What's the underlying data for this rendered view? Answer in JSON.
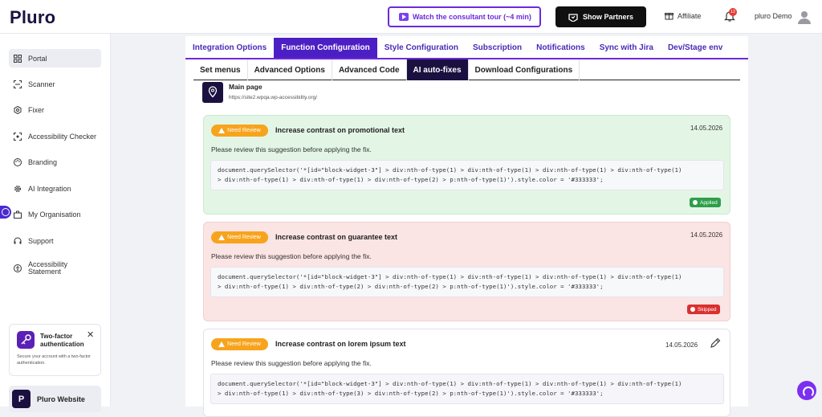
{
  "header": {
    "logo": "Pluro",
    "tour_button": "Watch the consultant tour (~4 min)",
    "partners_button": "Show Partners",
    "affiliate": "Affiliate",
    "notifications_count": "12",
    "user_name": "pluro Demo"
  },
  "sidebar": {
    "items": [
      {
        "label": "Portal",
        "icon": "grid-icon"
      },
      {
        "label": "Scanner",
        "icon": "scan-icon"
      },
      {
        "label": "Fixer",
        "icon": "fixer-icon"
      },
      {
        "label": "Accessibility Checker",
        "icon": "checker-icon"
      },
      {
        "label": "Branding",
        "icon": "palette-icon"
      },
      {
        "label": "AI Integration",
        "icon": "gear-icon"
      },
      {
        "label": "My Organisation",
        "icon": "briefcase-icon"
      },
      {
        "label": "Support",
        "icon": "headset-icon"
      },
      {
        "label": "Accessibility",
        "label2": "Statement",
        "icon": "accessibility-icon"
      }
    ],
    "twofa": {
      "title": "Two-factor authentication",
      "description": "Secure your account with a two-factor authentication."
    },
    "website_link": {
      "icon_letter": "P",
      "label": "Pluro Website"
    }
  },
  "tabs_primary": [
    "Integration Options",
    "Function Configuration",
    "Style Configuration",
    "Subscription",
    "Notifications",
    "Sync with Jira",
    "Dev/Stage env"
  ],
  "tabs_secondary": [
    "Set menus",
    "Advanced Options",
    "Advanced Code",
    "AI auto-fixes",
    "Download Configurations"
  ],
  "page": {
    "name": "Main page",
    "url": "https://site2.wpqa.wp-accessibility.org/"
  },
  "suggestions": [
    {
      "badge": "Need Review",
      "title": "Increase contrast on promotional text",
      "date": "14.05.2026",
      "description": "Please review this suggestion before applying the fix.",
      "code_line1": "document.querySelector('*[id=\"block-widget-3\"] > div:nth-of-type(1) > div:nth-of-type(1) > div:nth-of-type(1) > div:nth-of-type(1)",
      "code_line2": "> div:nth-of-type(1) > div:nth-of-type(1) > div:nth-of-type(2) > p:nth-of-type(1)').style.color = '#333333';",
      "status": "Applied"
    },
    {
      "badge": "Need Review",
      "title": "Increase contrast on guarantee text",
      "date": "14.05.2026",
      "description": "Please review this suggestion before applying the fix.",
      "code_line1": "document.querySelector('*[id=\"block-widget-3\"] > div:nth-of-type(1) > div:nth-of-type(1) > div:nth-of-type(1) > div:nth-of-type(1)",
      "code_line2": "> div:nth-of-type(1) > div:nth-of-type(2) > div:nth-of-type(2) > p:nth-of-type(1)').style.color = '#333333';",
      "status": "Skipped"
    },
    {
      "badge": "Need Review",
      "title": "Increase contrast on lorem ipsum text",
      "date": "14.05.2026",
      "description": "Please review this suggestion before applying the fix.",
      "code_line1": "document.querySelector('*[id=\"block-widget-3\"] > div:nth-of-type(1) > div:nth-of-type(1) > div:nth-of-type(1) > div:nth-of-type(1)",
      "code_line2": "> div:nth-of-type(1) > div:nth-of-type(3) > div:nth-of-type(2) > p:nth-of-type(1)').style.color = '#333333';"
    }
  ],
  "colors": {
    "brand": "#1b1140",
    "accent": "#6c2bd9",
    "applied": "#2e9e4a",
    "skipped": "#d93030",
    "review": "#f7a31c"
  }
}
